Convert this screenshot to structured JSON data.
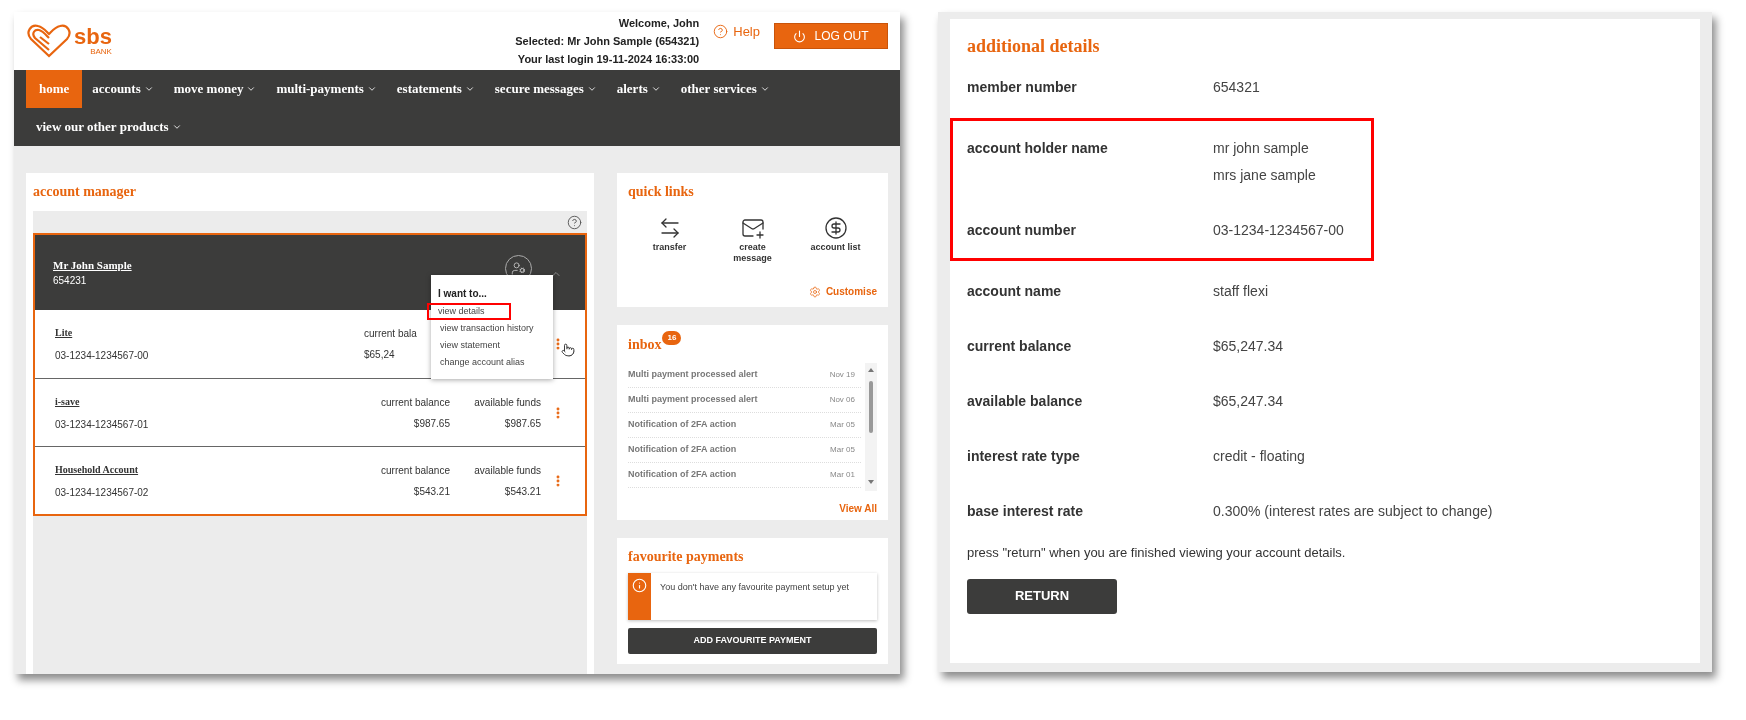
{
  "bank_portal": {
    "logo": {
      "name": "sbs",
      "sub": "BANK"
    },
    "welcome": "Welcome, John",
    "selected_member": "Selected: Mr John Sample (654321)",
    "last_login": "Your last login 19-11-2024 16:33:00",
    "help": "Help",
    "logout": "LOG OUT",
    "nav": [
      {
        "label": "home",
        "selected": true,
        "dropdown": false
      },
      {
        "label": "accounts",
        "selected": false,
        "dropdown": true
      },
      {
        "label": "move money",
        "selected": false,
        "dropdown": true
      },
      {
        "label": "multi-payments",
        "selected": false,
        "dropdown": true
      },
      {
        "label": "estatements",
        "selected": false,
        "dropdown": true
      },
      {
        "label": "secure messages",
        "selected": false,
        "dropdown": true
      },
      {
        "label": "alerts",
        "selected": false,
        "dropdown": true
      },
      {
        "label": "other services",
        "selected": false,
        "dropdown": true
      },
      {
        "label": "view our other products",
        "selected": false,
        "dropdown": true
      }
    ],
    "account_manager": {
      "title": "account manager",
      "customer": {
        "name": "Mr John Sample",
        "number": "654231"
      },
      "menu": {
        "heading": "I want to...",
        "items": [
          {
            "label": "view details",
            "highlighted": true
          },
          {
            "label": "view transaction history",
            "highlighted": false
          },
          {
            "label": "view statement",
            "highlighted": false
          },
          {
            "label": "change account alias",
            "highlighted": false
          }
        ]
      },
      "accounts": [
        {
          "name": "Lite",
          "number": "03-1234-1234567-00",
          "menu_open": true,
          "columns": [
            {
              "label": "current bala",
              "value": "$65,24"
            }
          ]
        },
        {
          "name": "i-save",
          "number": "03-1234-1234567-01",
          "menu_open": false,
          "columns": [
            {
              "label": "current balance",
              "value": "$987.65"
            },
            {
              "label": "available funds",
              "value": "$987.65"
            }
          ]
        },
        {
          "name": "Household Account",
          "number": "03-1234-1234567-02",
          "menu_open": false,
          "columns": [
            {
              "label": "current balance",
              "value": "$543.21"
            },
            {
              "label": "available funds",
              "value": "$543.21"
            }
          ]
        }
      ]
    },
    "quick_links": {
      "title": "quick links",
      "links": [
        {
          "label": "transfer",
          "kind": "transfer"
        },
        {
          "label": "create message",
          "kind": "message"
        },
        {
          "label": "account list",
          "kind": "dollar"
        }
      ],
      "customise": "Customise"
    },
    "inbox": {
      "title": "inbox",
      "count": "16",
      "messages": [
        {
          "subject": "Multi payment processed alert",
          "date": "Nov 19"
        },
        {
          "subject": "Multi payment processed alert",
          "date": "Nov 06"
        },
        {
          "subject": "Notification of 2FA action",
          "date": "Mar 05"
        },
        {
          "subject": "Notification of 2FA action",
          "date": "Mar 05"
        },
        {
          "subject": "Notification of 2FA action",
          "date": "Mar 01"
        }
      ],
      "view_all": "View All"
    },
    "favourite_payments": {
      "title": "favourite payments",
      "notice": "You don't have any favourite payment setup yet",
      "button": "ADD FAVOURITE PAYMENT"
    }
  },
  "additional_details": {
    "title": "additional details",
    "rows": [
      {
        "label": "member number",
        "values": [
          "654321"
        ],
        "highlighted": false
      },
      {
        "label": "account holder name",
        "values": [
          "mr john sample",
          "mrs jane sample"
        ],
        "highlighted": true
      },
      {
        "label": "account number",
        "values": [
          "03-1234-1234567-00"
        ],
        "highlighted": true
      },
      {
        "label": "account name",
        "values": [
          "staff flexi"
        ],
        "highlighted": false
      },
      {
        "label": "current balance",
        "values": [
          "$65,247.34"
        ],
        "highlighted": false
      },
      {
        "label": "available balance",
        "values": [
          "$65,247.34"
        ],
        "highlighted": false
      },
      {
        "label": "interest rate type",
        "values": [
          "credit - floating"
        ],
        "highlighted": false
      },
      {
        "label": "base interest rate",
        "values": [
          "0.300% (interest rates are subject to change)"
        ],
        "highlighted": false
      }
    ],
    "note": "press \"return\" when you are finished viewing your account details.",
    "button": "RETURN"
  }
}
